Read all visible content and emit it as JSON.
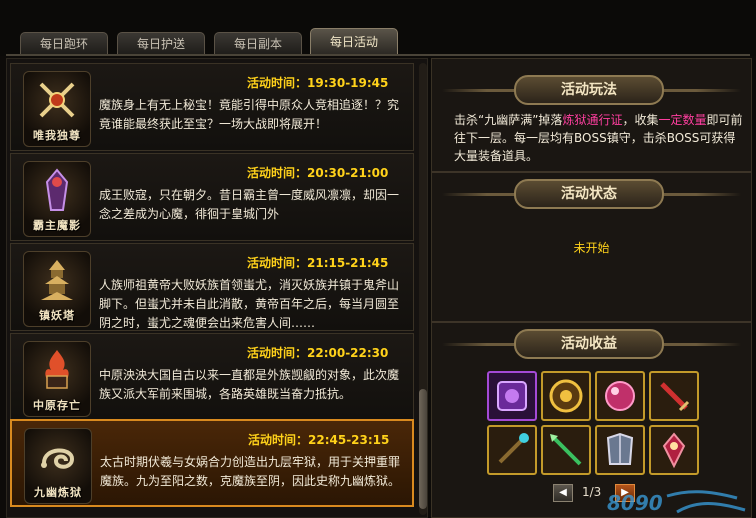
{
  "tabs": [
    {
      "label": "每日跑环",
      "active": false
    },
    {
      "label": "每日护送",
      "active": false
    },
    {
      "label": "每日副本",
      "active": false
    },
    {
      "label": "每日活动",
      "active": true
    }
  ],
  "activities": [
    {
      "icon": "crossed-swords-icon",
      "icon_label": "唯我独尊",
      "time": "活动时间：19:30-19:45",
      "desc": "魔族身上有无上秘宝！竟能引得中原众人竞相追逐！？究竟谁能最终获此至宝？一场大战即将展开！",
      "selected": false
    },
    {
      "icon": "demon-lord-icon",
      "icon_label": "霸主魔影",
      "time": "活动时间：20:30-21:00",
      "desc": "成王败寇，只在朝夕。昔日霸主曾一度威风凛凛，却因一念之差成为心魔，徘徊于皇城门外",
      "selected": false
    },
    {
      "icon": "pagoda-icon",
      "icon_label": "镇妖塔",
      "time": "活动时间：21:15-21:45",
      "desc": "人族师祖黄帝大败妖族首领蚩尤，消灭妖族并镇于鬼斧山脚下。但蚩尤并未自此消散，黄帝百年之后，每当月圆至阴之时，蚩尤之魂便会出来危害人间……",
      "selected": false
    },
    {
      "icon": "burning-city-icon",
      "icon_label": "中原存亡",
      "time": "活动时间：22:00-22:30",
      "desc": "中原泱泱大国自古以来一直都是外族觊觎的对象，此次魔族又派大军前来围城，各路英雄既当奋力抵抗。",
      "selected": false
    },
    {
      "icon": "serpent-icon",
      "icon_label": "九幽炼狱",
      "time": "活动时间：22:45-23:15",
      "desc": "太古时期伏羲与女娲合力创造出九层牢狱，用于关押重罪魔族。九为至阳之数，克魔族至阴，因此史称九幽炼狱。",
      "selected": true
    }
  ],
  "right": {
    "rules_title": "活动玩法",
    "rules": {
      "p1": "击杀“九幽萨满”掉落",
      "hl1": "炼狱通行证",
      "p2": "，收集",
      "hl2": "一定数量",
      "p3": "即可前往下一层。每一层均有BOSS镇守，击杀BOSS可获得大量装备道具。"
    },
    "status_title": "活动状态",
    "status": "未开始",
    "rewards_title": "活动收益",
    "rewards": [
      {
        "icon": "purple-book-icon",
        "rarity": "purple"
      },
      {
        "icon": "gold-medallion-icon",
        "rarity": "gold"
      },
      {
        "icon": "pink-orb-icon",
        "rarity": "gold"
      },
      {
        "icon": "red-sword-icon",
        "rarity": "gold"
      },
      {
        "icon": "jeweled-staff-icon",
        "rarity": "gold"
      },
      {
        "icon": "green-spear-icon",
        "rarity": "gold"
      },
      {
        "icon": "armor-icon",
        "rarity": "gold"
      },
      {
        "icon": "red-pendant-icon",
        "rarity": "gold"
      }
    ],
    "page": "1/3"
  },
  "colors": {
    "time": "#ffd21a",
    "highlight": "#ff3fa0",
    "selected_border": "#d98a1f"
  }
}
